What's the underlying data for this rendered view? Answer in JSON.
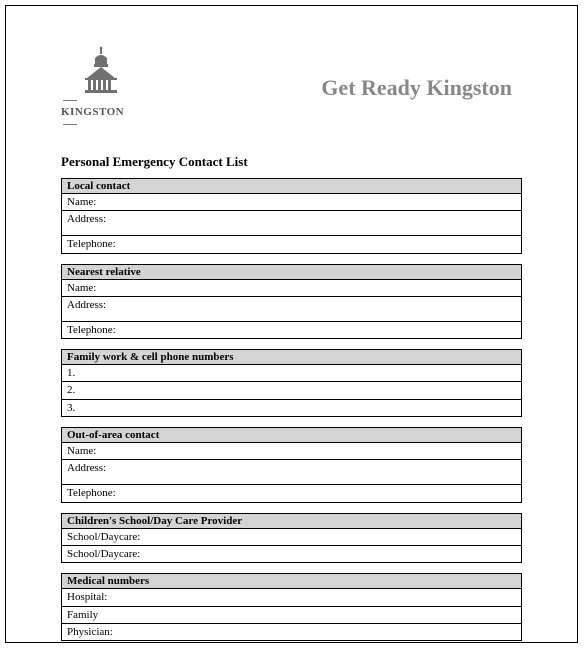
{
  "logo": {
    "text": "KINGSTON",
    "icon_name": "kingston-city-hall-icon"
  },
  "header": {
    "title": "Get Ready Kingston"
  },
  "doc_title": "Personal Emergency Contact List",
  "sections": [
    {
      "header": "Local contact",
      "rows": [
        "Name:",
        "Address:",
        "Telephone:"
      ],
      "tall_index": 1
    },
    {
      "header": "Nearest relative",
      "rows": [
        "Name:",
        "Address:",
        "Telephone:"
      ],
      "tall_index": 1
    },
    {
      "header": "Family work & cell phone numbers",
      "rows": [
        "1.",
        "2.",
        "3."
      ]
    },
    {
      "header": "Out-of-area contact",
      "rows": [
        "Name:",
        "Address:",
        "Telephone:"
      ],
      "tall_index": 1
    },
    {
      "header": "Children's School/Day Care Provider",
      "rows": [
        "School/Daycare:",
        "School/Daycare:"
      ]
    },
    {
      "header": "Medical numbers",
      "rows": [
        "Hospital:",
        "Family",
        "Physician:"
      ]
    }
  ]
}
